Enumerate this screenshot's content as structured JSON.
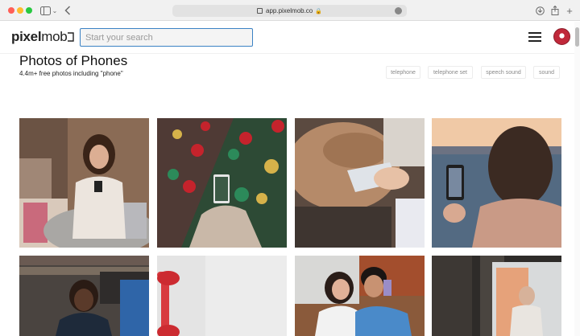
{
  "browser": {
    "url": "app.pixelmob.co",
    "traffic_lights": [
      "close",
      "minimize",
      "zoom"
    ]
  },
  "header": {
    "logo_bold": "pixel",
    "logo_light": "mob",
    "search_placeholder": "Start your search",
    "menu_icon": "hamburger-icon",
    "avatar_icon": "user-avatar"
  },
  "main": {
    "title": "Photos of Phones",
    "subtitle": "4.4m+ free photos including \"phone\"",
    "tags": [
      {
        "label": "telephone"
      },
      {
        "label": "telephone set"
      },
      {
        "label": "speech sound"
      },
      {
        "label": "sound"
      }
    ],
    "photos": [
      {
        "subject": "woman-on-sofa-with-phone-and-laptop"
      },
      {
        "subject": "phone-photographing-christmas-tree"
      },
      {
        "subject": "hands-holding-phone-with-bag"
      },
      {
        "subject": "woman-photographing-sunset-lake"
      },
      {
        "subject": "woman-on-phone-in-library"
      },
      {
        "subject": "red-telephone-handset"
      },
      {
        "subject": "couple-taking-selfie"
      },
      {
        "subject": "person-at-window-with-phone"
      }
    ]
  },
  "colors": {
    "accent": "#3b82c4",
    "avatar": "#c0283a"
  }
}
